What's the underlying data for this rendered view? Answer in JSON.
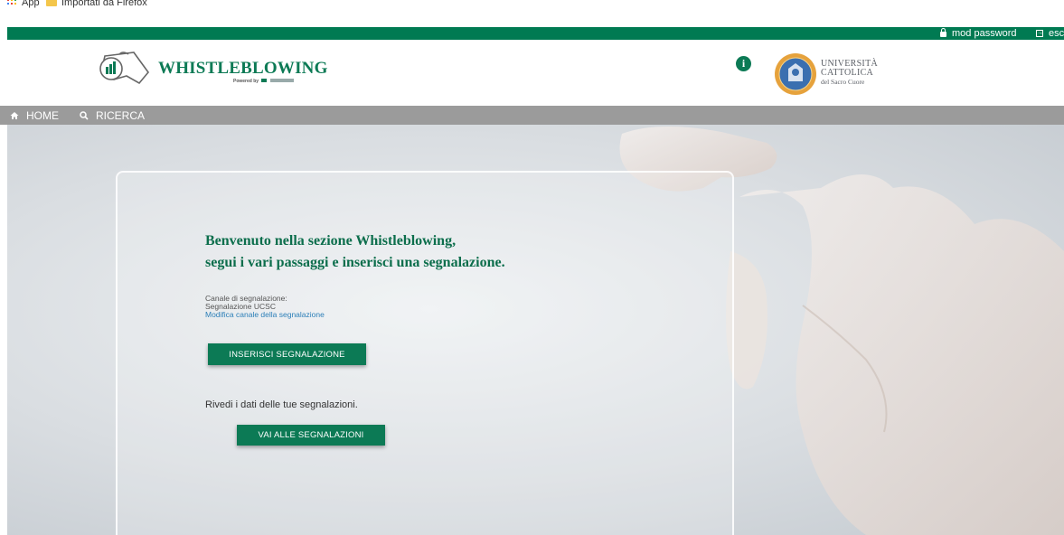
{
  "bookmarks": {
    "app": "App",
    "imported": "Importati da Firefox"
  },
  "topbar": {
    "change_password": "mod password",
    "exit": "esc"
  },
  "header": {
    "brand": "WHISTLEBLOWING",
    "powered_by": "Powered by",
    "university_line1": "UNIVERSITÀ",
    "university_line2": "CATTOLICA",
    "university_line3": "del Sacro Cuore",
    "info_symbol": "i"
  },
  "nav": {
    "home": "HOME",
    "search": "RICERCA"
  },
  "main": {
    "welcome_line1": "Benvenuto nella sezione Whistleblowing,",
    "welcome_line2": "segui i vari passaggi e inserisci una segnalazione.",
    "channel_label": "Canale di segnalazione:",
    "channel_value": "Segnalazione UCSC",
    "channel_change_link": "Modifica canale della segnalazione",
    "insert_button": "INSERISCI SEGNALAZIONE",
    "review_text": "Rivedi i dati delle tue segnalazioni.",
    "view_button": "VAI ALLE SEGNALAZIONI"
  },
  "colors": {
    "brand_green": "#0c7a55",
    "nav_gray": "#9b9b9b",
    "link_blue": "#2c7fb8"
  },
  "icons": [
    "apps-grid-icon",
    "folder-icon",
    "lock-icon",
    "exit-icon",
    "whistle-logo-icon",
    "info-icon",
    "university-seal-icon",
    "home-icon",
    "search-icon"
  ]
}
